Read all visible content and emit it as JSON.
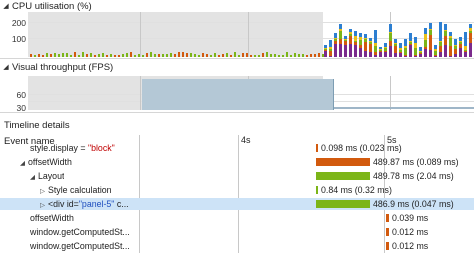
{
  "cpu_section": {
    "title": "CPU utilisation (%)",
    "y_labels": [
      "200",
      "100"
    ]
  },
  "fps_section": {
    "title": "Visual throughput (FPS)",
    "y_labels": [
      "60",
      "30"
    ]
  },
  "timeline": {
    "title": "Timeline details",
    "column_header": "Event name",
    "ticks": [
      "4s",
      "5s"
    ],
    "rows": [
      {
        "name": "style.display = \"block\"",
        "duration": "0.098 ms (0.023 ms)",
        "bar_color": "#d25a0e"
      },
      {
        "name": "offsetWidth",
        "duration": "489.87 ms (0.089 ms)",
        "bar_color": "#d25a0e"
      },
      {
        "name": "Layout",
        "duration": "489.78 ms (2.04 ms)",
        "bar_color": "#7cb518"
      },
      {
        "name": "Style calculation",
        "duration": "0.84 ms (0.32 ms)",
        "bar_color": "#7cb518"
      },
      {
        "name_prefix": "<div id=",
        "name_value": "\"panel-5\"",
        "name_suffix": " c...",
        "duration": "486.9 ms (0.047 ms)",
        "bar_color": "#7cb518"
      },
      {
        "name": "offsetWidth",
        "duration": "0.039 ms",
        "bar_color": "#d25a0e"
      },
      {
        "name": "window.getComputedSt...",
        "duration": "0.012 ms",
        "bar_color": "#d25a0e"
      },
      {
        "name": "window.getComputedSt...",
        "duration": "0.012 ms",
        "bar_color": "#d25a0e"
      }
    ]
  },
  "icons": {
    "collapse": "triangle-down-icon",
    "expand": "triangle-right-icon"
  }
}
